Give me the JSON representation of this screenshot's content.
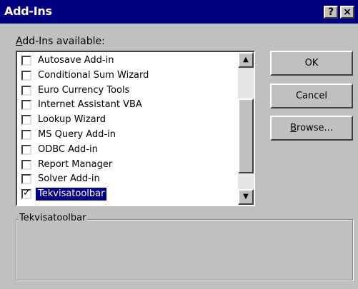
{
  "window": {
    "title": "Add-Ins",
    "help_glyph": "?",
    "close_glyph": "×"
  },
  "list": {
    "label_prefix": "A",
    "label_rest": "dd-Ins available:",
    "items": [
      {
        "label": "Autosave Add-in",
        "checked": false,
        "selected": false
      },
      {
        "label": "Conditional Sum Wizard",
        "checked": false,
        "selected": false
      },
      {
        "label": "Euro Currency Tools",
        "checked": false,
        "selected": false
      },
      {
        "label": "Internet Assistant VBA",
        "checked": false,
        "selected": false
      },
      {
        "label": "Lookup Wizard",
        "checked": false,
        "selected": false
      },
      {
        "label": "MS Query Add-in",
        "checked": false,
        "selected": false
      },
      {
        "label": "ODBC Add-in",
        "checked": false,
        "selected": false
      },
      {
        "label": "Report Manager",
        "checked": false,
        "selected": false
      },
      {
        "label": "Solver Add-in",
        "checked": false,
        "selected": false
      },
      {
        "label": "Tekvisatoolbar",
        "checked": true,
        "selected": true
      }
    ],
    "scroll_up_glyph": "▲",
    "scroll_down_glyph": "▼",
    "check_glyph": "✓"
  },
  "buttons": {
    "ok": "OK",
    "cancel": "Cancel",
    "browse_prefix": "B",
    "browse_rest": "rowse..."
  },
  "description": {
    "caption": "Tekvisatoolbar"
  },
  "colors": {
    "titlebar": "#000080",
    "selection": "#000080",
    "face": "#c0c0c0"
  }
}
